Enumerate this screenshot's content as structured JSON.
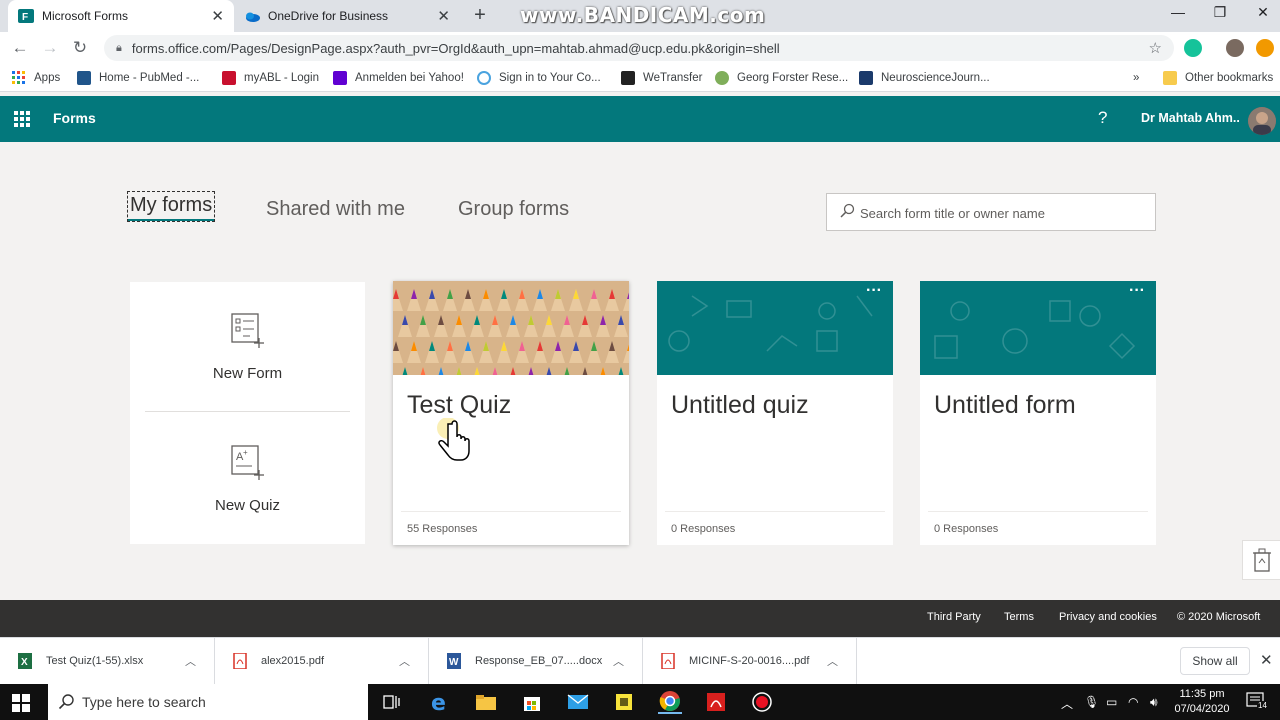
{
  "browser": {
    "tabs": [
      {
        "title": "Microsoft Forms"
      },
      {
        "title": "OneDrive for Business"
      }
    ],
    "watermark": "www.BANDICAM.com",
    "url": "forms.office.com/Pages/DesignPage.aspx?auth_pvr=OrgId&auth_upn=mahtab.ahmad@ucp.edu.pk&origin=shell",
    "bookmarks": [
      {
        "label": "Apps"
      },
      {
        "label": "Home - PubMed -..."
      },
      {
        "label": "myABL - Login"
      },
      {
        "label": "Anmelden bei Yahoo!"
      },
      {
        "label": "Sign in to Your Co..."
      },
      {
        "label": "WeTransfer"
      },
      {
        "label": "Georg Forster Rese..."
      },
      {
        "label": "NeuroscienceJourn..."
      }
    ],
    "bookmarks_more": "»",
    "other_bookmarks": "Other bookmarks"
  },
  "forms_header": {
    "brand": "Forms",
    "help": "?",
    "user": "Dr Mahtab Ahm.."
  },
  "pivots": [
    {
      "label": "My forms",
      "selected": true
    },
    {
      "label": "Shared with me",
      "selected": false
    },
    {
      "label": "Group forms",
      "selected": false
    }
  ],
  "search": {
    "placeholder": "Search form title or owner name",
    "value": ""
  },
  "new": {
    "form_label": "New Form",
    "quiz_label": "New Quiz"
  },
  "cards": [
    {
      "title": "Test Quiz",
      "responses": "55 Responses",
      "banner": "photo"
    },
    {
      "title": "Untitled quiz",
      "responses": "0 Responses",
      "banner": "teal"
    },
    {
      "title": "Untitled form",
      "responses": "0 Responses",
      "banner": "teal"
    }
  ],
  "card_more": "···",
  "footer": {
    "links": [
      "Third Party",
      "Terms",
      "Privacy and cookies",
      "© 2020 Microsoft"
    ]
  },
  "downloads": {
    "items": [
      {
        "name": "Test Quiz(1-55).xlsx",
        "type": "xlsx"
      },
      {
        "name": "alex2015.pdf",
        "type": "pdf"
      },
      {
        "name": "Response_EB_07.....docx",
        "type": "docx"
      },
      {
        "name": "MICINF-S-20-0016....pdf",
        "type": "pdf"
      }
    ],
    "show_all": "Show all"
  },
  "taskbar": {
    "search_placeholder": "Type here to search",
    "time": "11:35 pm",
    "date": "07/04/2020",
    "notifications": "14"
  },
  "colors": {
    "forms_teal": "#03787c",
    "footer": "#323130",
    "background": "#f3f2f1"
  }
}
